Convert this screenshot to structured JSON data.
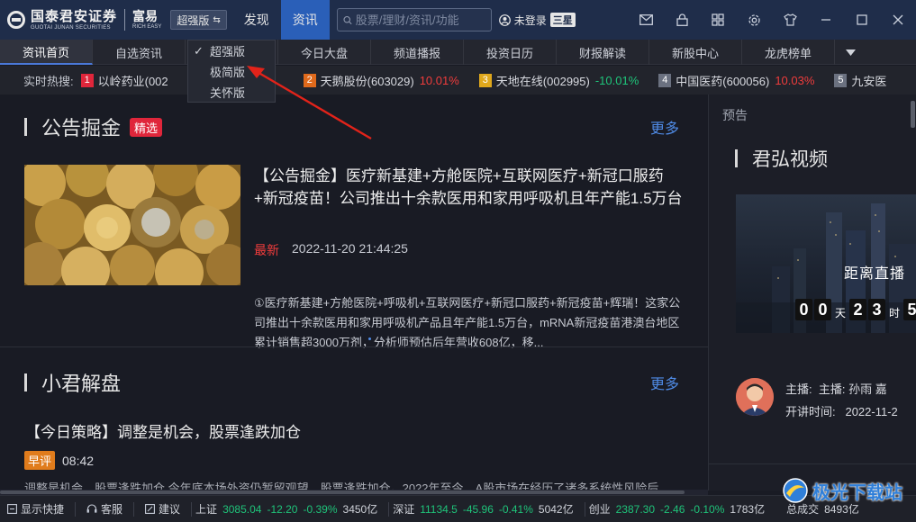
{
  "titlebar": {
    "logo_cn": "国泰君安证券",
    "logo_en": "GUOTAI JUNAN SECURITIES",
    "logo2_cn": "富易",
    "logo2_en": "RICH EASY",
    "mode_label": "超强版",
    "nav": [
      "发现",
      "资讯"
    ],
    "search_placeholder": "股票/理财/资讯/功能",
    "user_label": "未登录",
    "user_badge": "三星"
  },
  "tabs": [
    "资讯首页",
    "自选资讯",
    "",
    "今日大盘",
    "频道播报",
    "投资日历",
    "财报解读",
    "新股中心",
    "龙虎榜单"
  ],
  "dropdown": {
    "options": [
      "超强版",
      "极简版",
      "关怀版"
    ],
    "checked": 0
  },
  "hotbar": {
    "label": "实时热搜:",
    "items": [
      {
        "rank": "1",
        "name": "以岭药业(002",
        "change": "",
        "rank_color": "#e0263b"
      },
      {
        "rank": "2",
        "name": "天鹅股份(603029)",
        "change": "10.01%",
        "dir": "up",
        "rank_color": "#e06a1c"
      },
      {
        "rank": "3",
        "name": "天地在线(002995)",
        "change": "-10.01%",
        "dir": "down",
        "rank_color": "#e0a81c"
      },
      {
        "rank": "4",
        "name": "中国医药(600056)",
        "change": "10.03%",
        "dir": "up",
        "rank_color": "#6b7180"
      },
      {
        "rank": "5",
        "name": "九安医",
        "change": "",
        "rank_color": "#6b7180"
      }
    ]
  },
  "section1": {
    "title": "公告掘金",
    "tag": "精选",
    "more": "更多",
    "article": {
      "title": "【公告掘金】医疗新基建+方舱医院+互联网医疗+新冠口服药+新冠疫苗！公司推出十余款医用和家用呼吸机且年产能1.5万台",
      "latest": "最新",
      "time": "2022-11-20 21:44:25",
      "summary": "①医疗新基建+方舱医院+呼吸机+互联网医疗+新冠口服药+新冠疫苗+辉瑞！这家公司推出十余款医用和家用呼吸机产品且年产能1.5万台，mRNA新冠疫苗港澳台地区累计销售超3000万剂，分析师预估后年营收608亿，移..."
    }
  },
  "section2": {
    "title": "小君解盘",
    "more": "更多",
    "article": {
      "title": "【今日策略】调整是机会，股票逢跌加仓",
      "tag": "早评",
      "time": "08:42",
      "summary": "调整是机会，股票逢跌加仓 今年底本场外资仍暂留观望，股票逢跌加仓。2022年至今，A股市场在经历了诸多系统性风险后..."
    }
  },
  "side": {
    "pre_label": "预告",
    "title": "君弘视频",
    "video_title": "距离直播",
    "countdown": {
      "d1": "0",
      "d2": "0",
      "unit1": "天",
      "h1": "2",
      "h2": "3",
      "unit2": "时",
      "m1": "5"
    },
    "host_label": "主播:",
    "host_value": "主播: 孙雨 嘉",
    "time_label": "开讲时间:",
    "time_value": "2022-11-2"
  },
  "statusbar": {
    "buttons": [
      "显示快捷",
      "客服",
      "建议"
    ],
    "indices": [
      {
        "name": "上证",
        "value": "3085.04",
        "change": "-12.20",
        "pct": "-0.39%",
        "amount": "3450亿"
      },
      {
        "name": "深证",
        "value": "11134.5",
        "change": "-45.96",
        "pct": "-0.41%",
        "amount": "5042亿"
      },
      {
        "name": "创业",
        "value": "2387.30",
        "change": "-2.46",
        "pct": "-0.10%",
        "amount": "1783亿"
      }
    ],
    "total_label": "总成交",
    "total_value": "8493亿"
  },
  "watermark": "极光下载站"
}
